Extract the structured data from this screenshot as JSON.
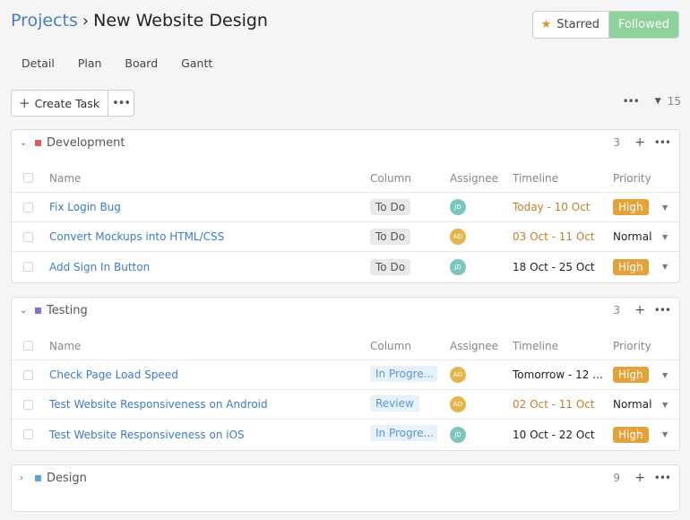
{
  "header": {
    "crumb": "Projects",
    "separator": "›",
    "title": "New Website Design"
  },
  "actions": {
    "starred": "Starred",
    "followed": "Followed"
  },
  "views": [
    "Detail",
    "Plan",
    "Board",
    "Gantt"
  ],
  "toolbar": {
    "create_task": "Create Task",
    "total_count": "15"
  },
  "columns": {
    "name": "Name",
    "column": "Column",
    "assignee": "Assignee",
    "timeline": "Timeline",
    "priority": "Priority"
  },
  "groups": [
    {
      "name": "Development",
      "color": "#e05c5c",
      "count": "3",
      "expanded": true,
      "tasks": [
        {
          "name": "Fix Login Bug",
          "column": "To Do",
          "assignee": "JD",
          "timeline": "Today - 10 Oct",
          "priority": "High"
        },
        {
          "name": "Convert Mockups into HTML/CSS",
          "column": "To Do",
          "assignee": "AD",
          "timeline": "03 Oct - 11 Oct",
          "priority": "Normal"
        },
        {
          "name": "Add Sign In Button",
          "column": "To Do",
          "assignee": "JD",
          "timeline": "18 Oct - 25 Oct",
          "priority": "High"
        }
      ]
    },
    {
      "name": "Testing",
      "color": "#8a6fd0",
      "count": "3",
      "expanded": true,
      "tasks": [
        {
          "name": "Check Page Load Speed",
          "column": "In Progre...",
          "assignee": "AD",
          "timeline": "Tomorrow - 12 ...",
          "priority": "High"
        },
        {
          "name": "Test Website Responsiveness on Android",
          "column": "Review",
          "assignee": "AD",
          "timeline": "02 Oct - 11 Oct",
          "priority": "Normal"
        },
        {
          "name": "Test Website Responsiveness on iOS",
          "column": "In Progre...",
          "assignee": "JD",
          "timeline": "10 Oct - 22 Oct",
          "priority": "High"
        }
      ]
    },
    {
      "name": "Design",
      "color": "#5aa6d6",
      "count": "9",
      "expanded": false
    }
  ]
}
